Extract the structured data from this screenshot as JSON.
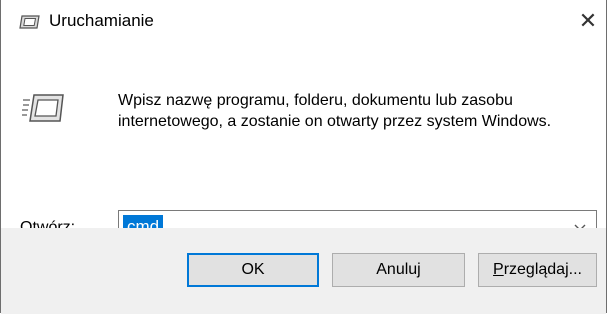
{
  "window": {
    "title": "Uruchamianie",
    "close_glyph": "✕",
    "icon": "run-icon"
  },
  "main": {
    "description": "Wpisz nazwę programu, folderu, dokumentu lub zasobu internetowego, a zostanie on otwarty przez system Windows.",
    "open_label_accesskey": "O",
    "open_label_rest": "twórz:",
    "combo_value": "cmd",
    "combo_arrow_icon": "chevron-down-icon"
  },
  "buttons": {
    "ok": "OK",
    "cancel": "Anuluj",
    "browse_accesskey": "P",
    "browse_rest": "rzeglądaj..."
  },
  "colors": {
    "selection": "#0078d7",
    "footer_bg": "#f0f0f0",
    "button_bg": "#e1e1e1",
    "default_button_border": "#0078d7"
  }
}
